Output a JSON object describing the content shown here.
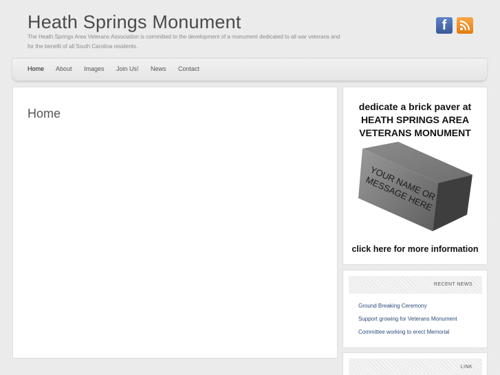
{
  "header": {
    "title": "Heath Springs Monument",
    "description": "The Heath Springs Area Veterans Association is committed to the development of a monument dedicated to all war veterans and for the benefit of all South Carolina residents.",
    "social": [
      {
        "icon": "facebook-icon",
        "glyph": "f",
        "color": "#3b5998"
      },
      {
        "icon": "rss-icon",
        "color": "#f08a24"
      }
    ]
  },
  "nav": {
    "items": [
      {
        "label": "Home",
        "active": true
      },
      {
        "label": "About"
      },
      {
        "label": "Images"
      },
      {
        "label": "Join Us!"
      },
      {
        "label": "News"
      },
      {
        "label": "Contact"
      }
    ]
  },
  "main": {
    "heading": "Home"
  },
  "sidebar": {
    "ad": {
      "lines": [
        "dedicate a brick paver at",
        "HEATH SPRINGS AREA",
        "VETERANS MONUMENT"
      ],
      "brick_text": [
        "YOUR NAME OR",
        "MESSAGE HERE"
      ],
      "footer": "click here for more information"
    },
    "recent_news": {
      "title": "RECENT NEWS",
      "items": [
        "Ground Breaking Ceremony",
        "Support growing for Veterans Monument",
        "Committee working to erect Memorial"
      ]
    },
    "link": {
      "title": "LINK"
    }
  }
}
